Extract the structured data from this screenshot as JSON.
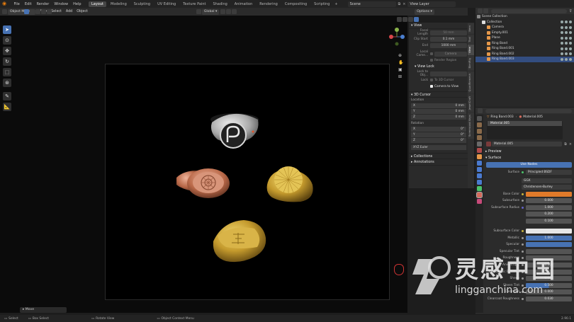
{
  "menu": [
    "File",
    "Edit",
    "Render",
    "Window",
    "Help"
  ],
  "workspaces": [
    "Layout",
    "Modeling",
    "Sculpting",
    "UV Editing",
    "Texture Paint",
    "Shading",
    "Animation",
    "Rendering",
    "Compositing",
    "Scripting"
  ],
  "active_workspace": "Layout",
  "scene": "Scene",
  "view_layer": "View Layer",
  "header": {
    "mode": "Object Mode",
    "view": "View",
    "select": "Select",
    "add": "Add",
    "object": "Object",
    "orientation": "Global",
    "options": "Options"
  },
  "npanel": {
    "view_header": "View",
    "focal_length_label": "Focal Length",
    "focal_length": "50 mm",
    "clip_start_label": "Clip Start",
    "clip_start": "0.1 mm",
    "end_label": "End",
    "end": "1000 mm",
    "local_camera_label": "Local Came...",
    "camera": "Camera",
    "render_region": "Render Region",
    "view_lock": "View Lock",
    "lock_to_obj": "Lock to Obj...",
    "lock": "Lock",
    "to_3d_cursor": "To 3D Cursor",
    "camera_to_view": "Camera to View",
    "cursor_header": "3D Cursor",
    "location": "Location",
    "loc_x": "0 mm",
    "loc_y": "0 mm",
    "loc_z": "0 mm",
    "rotation": "Rotation",
    "rot_x": "0°",
    "rot_y": "0°",
    "rot_z": "0°",
    "x": "X",
    "y": "Y",
    "z": "Z",
    "rotation_mode": "XYZ Euler",
    "collections": "Collections",
    "annotations": "Annotations"
  },
  "ntabs": [
    "Item",
    "Tool",
    "View",
    "BlenRig",
    "QuadRemesh",
    "JewelCraft",
    "Screencast Keys"
  ],
  "active_ntab": "View",
  "outliner": {
    "title": "Scene Collection",
    "items": [
      {
        "name": "Collection",
        "indent": 1,
        "color": "#dddddd"
      },
      {
        "name": "Camera",
        "indent": 2,
        "color": "#e6984a"
      },
      {
        "name": "Empty.001",
        "indent": 2,
        "color": "#e6984a"
      },
      {
        "name": "Plane",
        "indent": 2,
        "color": "#e6984a"
      },
      {
        "name": "Ring Band",
        "indent": 2,
        "color": "#e6984a"
      },
      {
        "name": "Ring Band.001",
        "indent": 2,
        "color": "#e6984a"
      },
      {
        "name": "Ring Band.002",
        "indent": 2,
        "color": "#e6984a"
      },
      {
        "name": "Ring Band.003",
        "indent": 2,
        "color": "#e6984a",
        "selected": true
      }
    ]
  },
  "properties": {
    "object": "Ring Band.003",
    "material": "Material.005",
    "slot": "Material.005",
    "material_name": "Material.005",
    "preview": "Preview",
    "surface_section": "Surface",
    "use_nodes": "Use Nodes",
    "surface_label": "Surface",
    "surface_value": "Principled BSDF",
    "distribution": "GGX",
    "subsurface_method": "Christensen-Burley",
    "base_color": "Base Color",
    "subsurface": "Subsurface",
    "subsurface_val": "0.000",
    "subsurface_radius": "Subsurface Radius",
    "radius_1": "1.000",
    "radius_2": "0.200",
    "radius_3": "0.100",
    "subsurface_color": "Subsurface Color",
    "metallic": "Metallic",
    "metallic_val": "1.000",
    "specular": "Specular",
    "specular_tint": "Specular Tint",
    "roughness": "Roughness",
    "anisotropic": "Anisotropic",
    "anisotropic_val": "0.000",
    "anisotropic_rotation": "Anisotropic Rotation",
    "sheen": "Sheen",
    "sheen_val": "0.000",
    "sheen_tint": "Sheen Tint",
    "sheen_tint_val": "0.500",
    "clearcoat": "Clearcoat",
    "clearcoat_val": "0.000",
    "clearcoat_roughness": "Clearcoat Roughness",
    "clearcoat_roughness_val": "0.030",
    "base_color_hex": "#e07a2a"
  },
  "move_panel": "Move",
  "status": {
    "select": "Select",
    "box_select": "Box Select",
    "rotate_view": "Rotate View",
    "context_menu": "Object Context Menu",
    "version": "2.90.1"
  },
  "watermark": {
    "cn": "灵感中国",
    "url": "lingganchina.com"
  },
  "colors": {
    "accent": "#4772b3",
    "orange": "#e87d0d",
    "gold": "#c9a233",
    "rose_gold": "#c97a5a",
    "silver": "#c9c9c9"
  }
}
